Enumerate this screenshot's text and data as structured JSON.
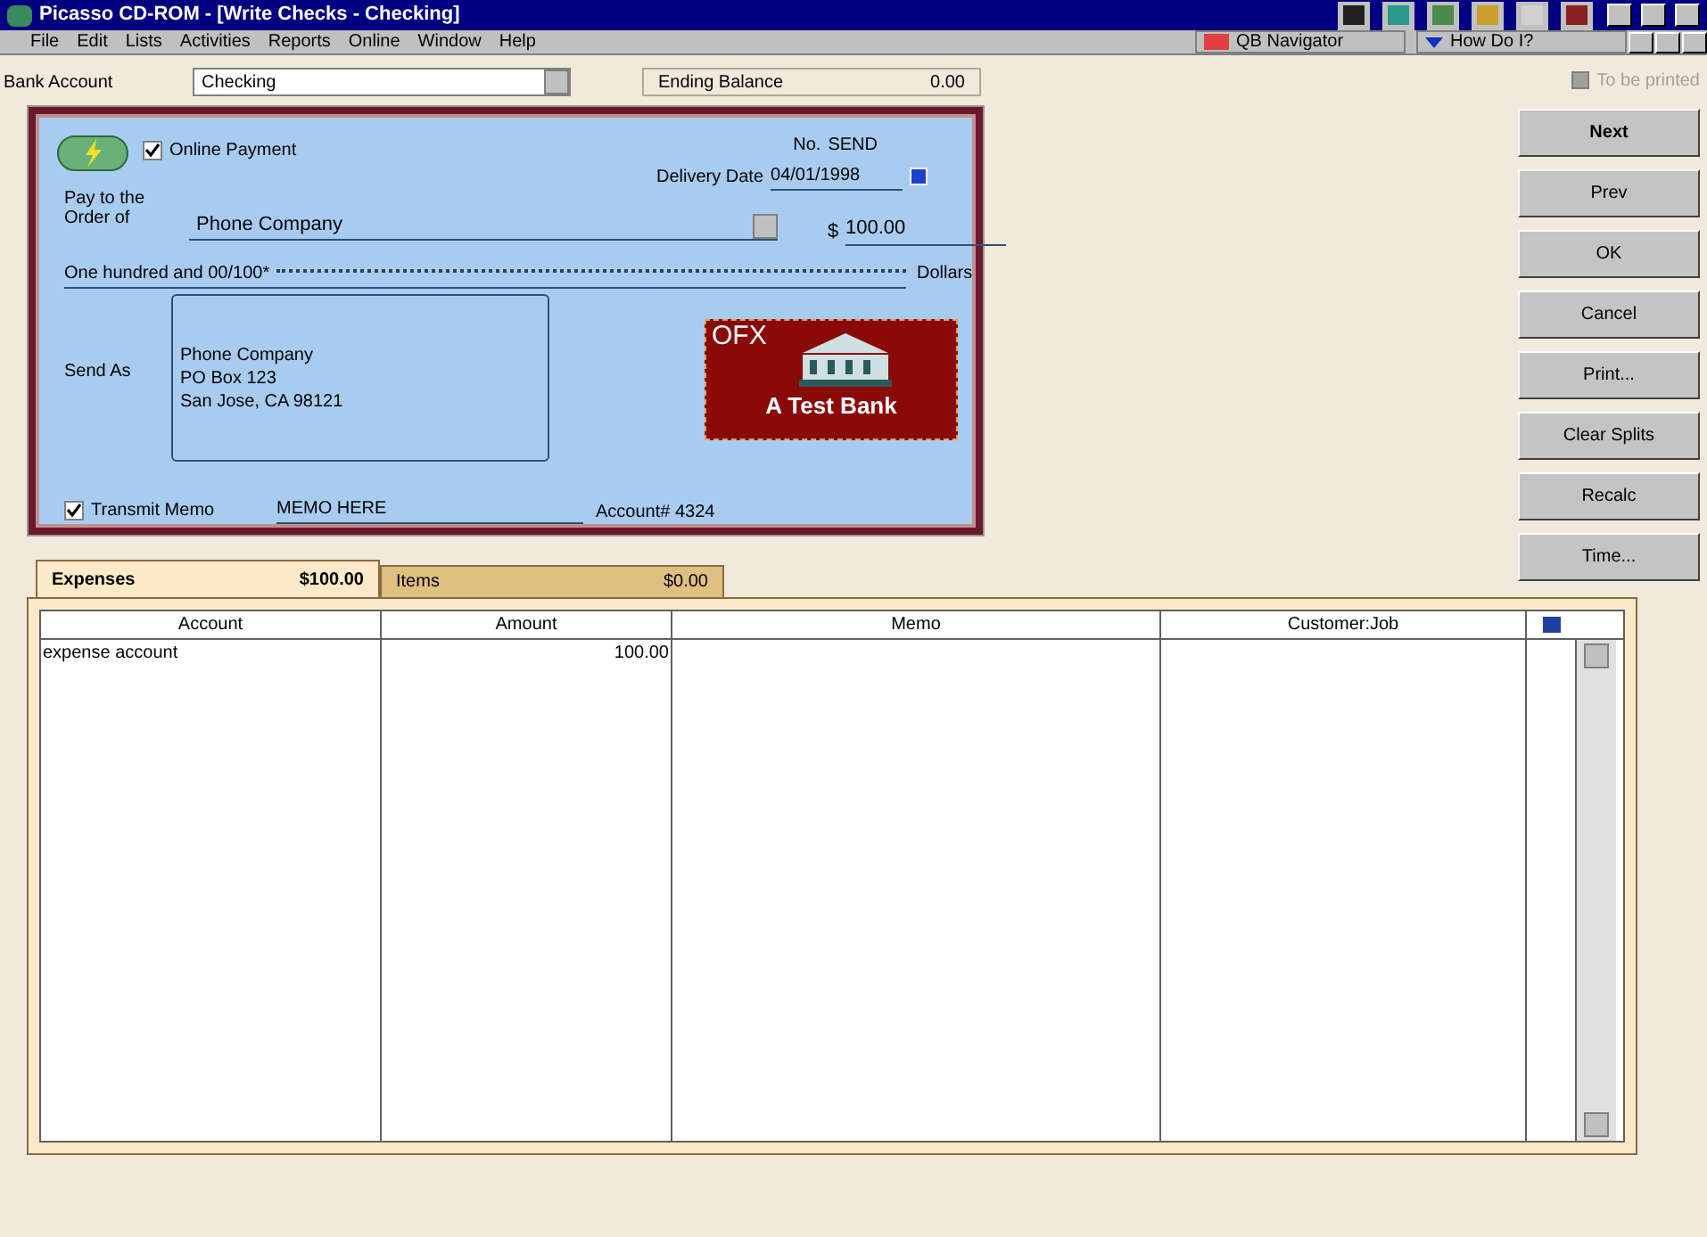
{
  "window": {
    "title": "Picasso CD-ROM - [Write Checks - Checking]"
  },
  "menu": [
    "File",
    "Edit",
    "Lists",
    "Activities",
    "Reports",
    "Online",
    "Window",
    "Help"
  ],
  "menu_right": [
    "QB Navigator",
    "How Do I?"
  ],
  "bank_account": {
    "label": "Bank Account",
    "value": "Checking"
  },
  "ending_balance": {
    "label": "Ending Balance",
    "value": "0.00"
  },
  "to_be_printed": {
    "label": "To be printed",
    "checked": false
  },
  "check": {
    "online_payment": {
      "label": "Online Payment",
      "checked": true
    },
    "no_label": "No.",
    "no_value": "SEND",
    "delivery_date_label": "Delivery Date",
    "delivery_date": "04/01/1998",
    "pay_to_label": "Pay to the Order of",
    "payee": "Phone Company",
    "currency": "$",
    "amount": "100.00",
    "amount_words": "One hundred and 00/100*",
    "dollars_label": "Dollars",
    "send_as_label": "Send As",
    "address": [
      "Phone Company",
      "PO Box 123",
      "San Jose, CA 98121"
    ],
    "bank_logo": {
      "brand": "OFX",
      "name": "A Test Bank"
    },
    "transmit_memo": {
      "label": "Transmit Memo",
      "checked": true
    },
    "memo": "MEMO HERE",
    "account_no": "Account# 4324"
  },
  "buttons": [
    "Next",
    "Prev",
    "OK",
    "Cancel",
    "Print...",
    "Clear Splits",
    "Recalc",
    "Time..."
  ],
  "tabs": [
    {
      "label": "Expenses",
      "amount": "$100.00",
      "selected": true
    },
    {
      "label": "Items",
      "amount": "$0.00",
      "selected": false
    }
  ],
  "table": {
    "columns": [
      "Account",
      "Amount",
      "Memo",
      "Customer:Job"
    ],
    "rows": [
      [
        "expense account",
        "100.00",
        "",
        ""
      ]
    ]
  }
}
